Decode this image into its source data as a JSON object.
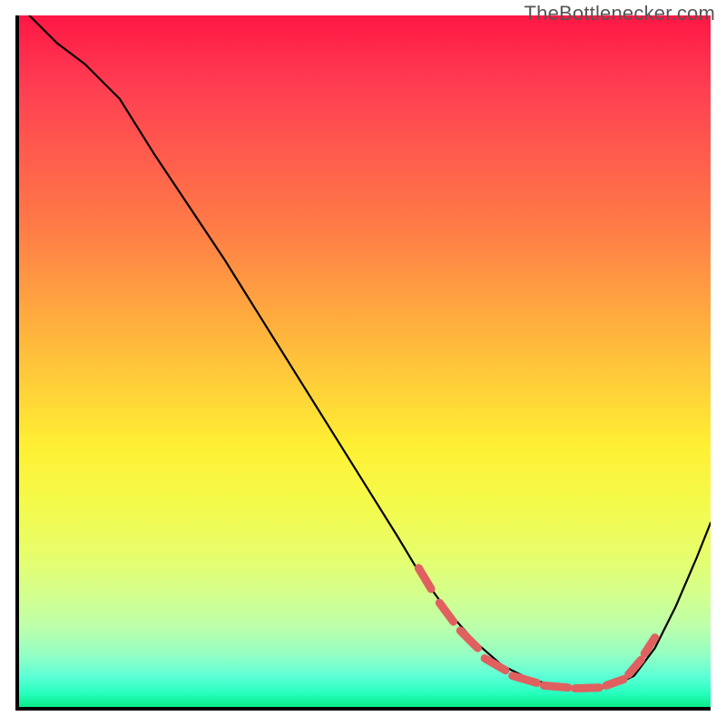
{
  "watermark": "TheBottlenecker.com",
  "chart_data": {
    "type": "line",
    "title": "",
    "xlabel": "",
    "ylabel": "",
    "xlim": [
      0,
      100
    ],
    "ylim": [
      0,
      100
    ],
    "grid": false,
    "legend": false,
    "series": [
      {
        "name": "curve",
        "x": [
          2,
          6,
          10,
          15,
          20,
          25,
          30,
          35,
          40,
          45,
          50,
          55,
          58,
          62,
          66,
          70,
          74,
          78,
          82,
          84,
          86,
          89,
          92,
          95,
          98,
          100
        ],
        "y": [
          100,
          96,
          93,
          88,
          80,
          72.5,
          65,
          57,
          49,
          41,
          33,
          25,
          20,
          14.5,
          10,
          6.5,
          4.5,
          3.5,
          3.2,
          3.2,
          3.6,
          5,
          9,
          15,
          22,
          27
        ]
      }
    ],
    "markers": {
      "name": "highlight-dashes",
      "color": "#e06060",
      "segments": [
        {
          "x0": 58.0,
          "y0": 20.5,
          "x1": 59.8,
          "y1": 17.5
        },
        {
          "x0": 61.0,
          "y0": 15.5,
          "x1": 63.0,
          "y1": 12.8
        },
        {
          "x0": 64.0,
          "y0": 11.5,
          "x1": 66.5,
          "y1": 9.0
        },
        {
          "x0": 67.5,
          "y0": 7.5,
          "x1": 70.5,
          "y1": 5.8
        },
        {
          "x0": 71.5,
          "y0": 5.0,
          "x1": 75.0,
          "y1": 4.0
        },
        {
          "x0": 76.0,
          "y0": 3.6,
          "x1": 79.5,
          "y1": 3.3
        },
        {
          "x0": 80.5,
          "y0": 3.2,
          "x1": 84.0,
          "y1": 3.3
        },
        {
          "x0": 85.0,
          "y0": 3.6,
          "x1": 87.5,
          "y1": 4.5
        },
        {
          "x0": 88.2,
          "y0": 5.2,
          "x1": 90.0,
          "y1": 7.3
        },
        {
          "x0": 90.5,
          "y0": 8.2,
          "x1": 92.0,
          "y1": 10.5
        }
      ]
    },
    "background": {
      "type": "vertical-gradient",
      "stops": [
        {
          "pos": 0,
          "color": "#ff1744"
        },
        {
          "pos": 50,
          "color": "#ffd238"
        },
        {
          "pos": 100,
          "color": "#00e676"
        }
      ]
    }
  }
}
